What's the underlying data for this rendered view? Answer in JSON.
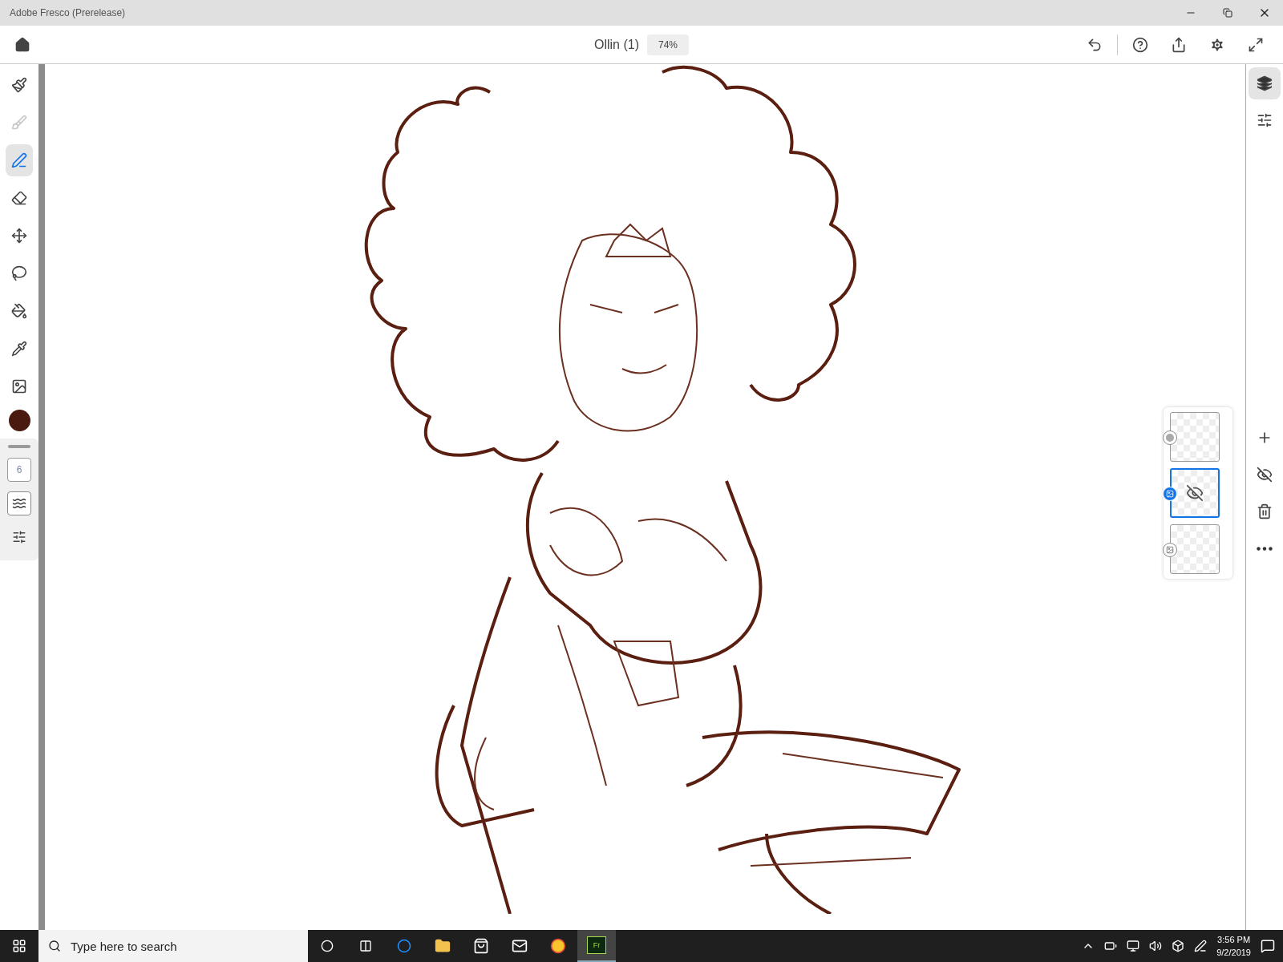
{
  "window": {
    "title": "Adobe Fresco (Prerelease)"
  },
  "app_bar": {
    "document_title": "Ollin (1)",
    "zoom": "74%"
  },
  "tools": [
    {
      "selected": false,
      "disabled": false
    },
    {
      "selected": false,
      "disabled": true
    },
    {
      "selected": true,
      "disabled": false
    },
    {
      "selected": false,
      "disabled": false
    },
    {
      "selected": false,
      "disabled": false
    },
    {
      "selected": false,
      "disabled": false
    },
    {
      "selected": false,
      "disabled": false
    },
    {
      "selected": false,
      "disabled": false
    },
    {
      "selected": false,
      "disabled": false
    }
  ],
  "color_swatch": {
    "color": "#4a1a0e"
  },
  "brush_size": "6",
  "side_panel": {
    "layers_open": true
  },
  "layers": [
    {
      "kind": "pixel",
      "selected": false,
      "hidden": false
    },
    {
      "kind": "image",
      "selected": true,
      "hidden": true
    },
    {
      "kind": "image",
      "selected": false,
      "hidden": false
    }
  ],
  "taskbar": {
    "search_placeholder": "Type here to search",
    "app_logo": "Fr",
    "time": "3:56 PM",
    "date": "9/2/2019"
  }
}
